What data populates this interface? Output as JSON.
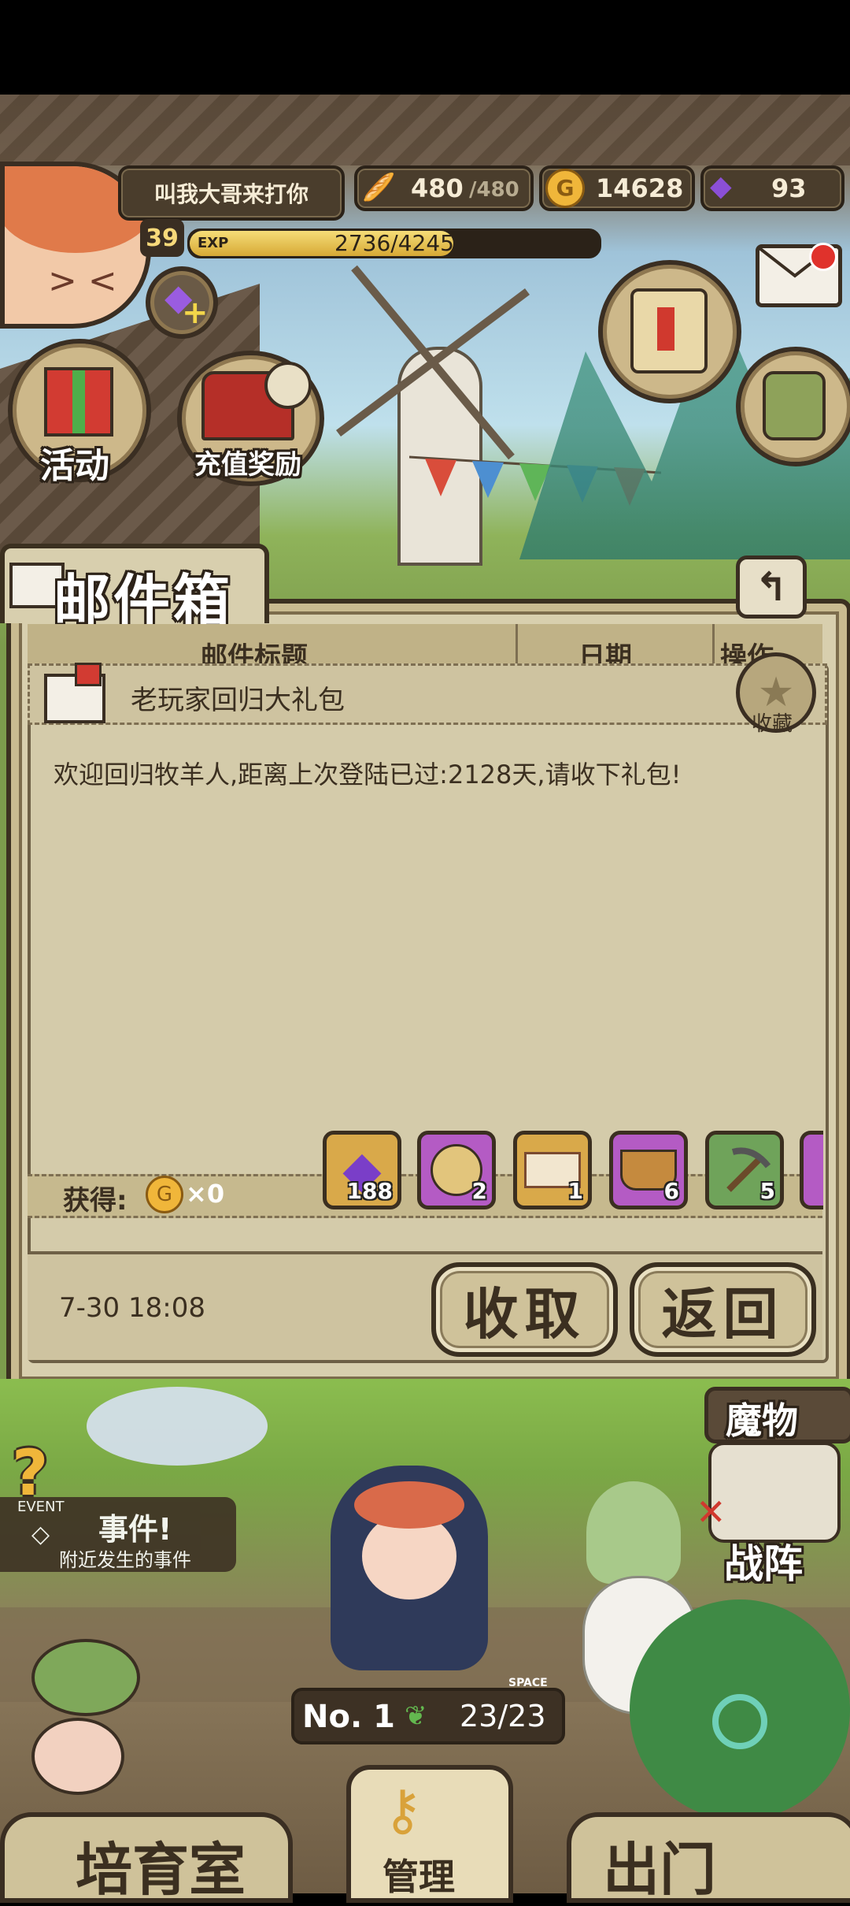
{
  "player": {
    "name": "叫我大哥来打你",
    "level": "39",
    "exp_label": "EXP",
    "exp_text": "2736/4245",
    "exp_fraction": 0.645
  },
  "resources": {
    "bread": "480",
    "bread_max": "/480",
    "gold": "14628",
    "gems": "93"
  },
  "town_buttons": {
    "activity": "活动",
    "recharge_reward": "充值奖励"
  },
  "mailbox": {
    "title": "邮件箱",
    "columns": [
      "邮件标题",
      "日期",
      "操作"
    ],
    "mail_subject": "老玩家回归大礼包",
    "favorite_label": "收藏",
    "body": "欢迎回归牧羊人,距离上次登陆已过:2128天,请收下礼包!",
    "gain_label": "获得:",
    "gold_gain": "×0",
    "rewards": [
      {
        "name": "gem",
        "count": "188"
      },
      {
        "name": "bread-bag",
        "count": "2"
      },
      {
        "name": "ticket",
        "count": "1"
      },
      {
        "name": "bread-basket",
        "count": "6"
      },
      {
        "name": "pickaxe",
        "count": "5"
      }
    ],
    "date": "7-30 18:08",
    "collect_button": "收取",
    "back_button": "返回"
  },
  "bottom": {
    "event_tag": "EVENT",
    "event_title": "事件!",
    "event_sub": "附近发生的事件",
    "monster_label": "魔物",
    "formation_label": "战阵",
    "rank": "No. 1",
    "space_label": "SPACE",
    "space_count": "23/23",
    "nursery": "培育室",
    "manage": "管理",
    "go_out": "出门"
  }
}
